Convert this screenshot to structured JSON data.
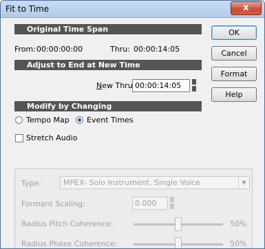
{
  "window": {
    "title": "Fit to Time",
    "close_label": "x"
  },
  "original": {
    "header": "Original Time Span",
    "from_label": "From:",
    "from_value": "00:00:00:00",
    "thru_label": "Thru:",
    "thru_value": "00:00:14:05"
  },
  "adjust": {
    "header": "Adjust to End at New Time",
    "new_thru_label": "New Thru:",
    "new_thru_value": "00:00:14:05"
  },
  "modify": {
    "header": "Modify by Changing",
    "tempo_map_label": "Tempo Map",
    "event_times_label": "Event Times",
    "selected": "Event Times"
  },
  "stretch_audio": {
    "label": "Stretch Audio",
    "checked": false
  },
  "buttons": {
    "ok": "OK",
    "cancel": "Cancel",
    "format": "Format",
    "help": "Help"
  },
  "panel": {
    "type_label": "Type:",
    "type_value": "MPEX- Solo Instrument, Single Voice",
    "formant_label": "Formant Scaling:",
    "formant_value": "0.000",
    "pitch_label": "Radius Pitch Coherence:",
    "pitch_value": "50%",
    "phase_label": "Radius Phase Coherence:",
    "phase_value": "50%"
  }
}
